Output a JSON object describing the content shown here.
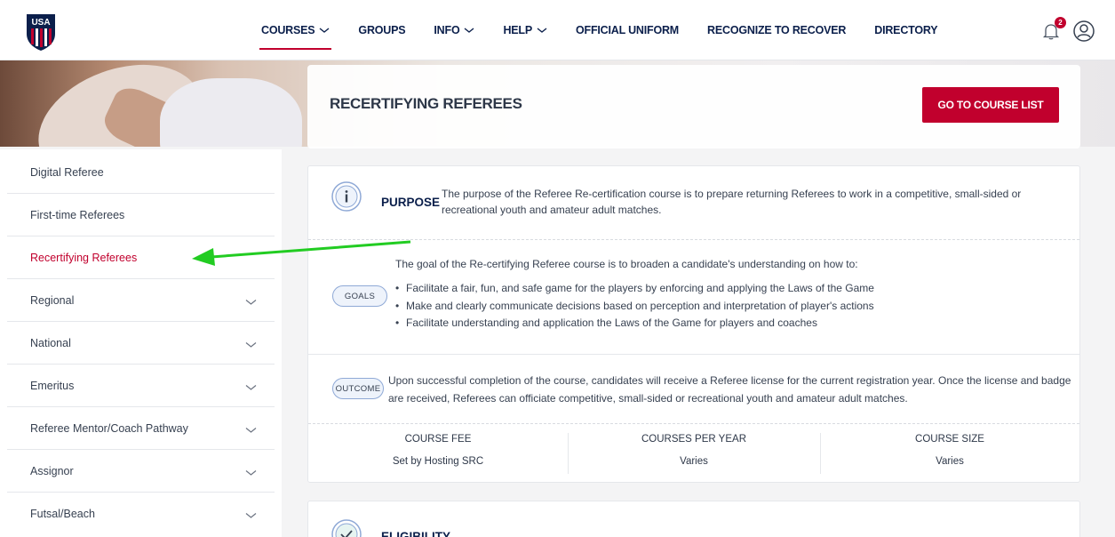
{
  "header": {
    "logo_text": "USA",
    "nav": [
      {
        "label": "COURSES",
        "has_chevron": true,
        "active": true
      },
      {
        "label": "GROUPS",
        "has_chevron": false
      },
      {
        "label": "INFO",
        "has_chevron": true
      },
      {
        "label": "HELP",
        "has_chevron": true
      },
      {
        "label": "OFFICIAL UNIFORM",
        "has_chevron": false
      },
      {
        "label": "RECOGNIZE TO RECOVER",
        "has_chevron": false
      },
      {
        "label": "DIRECTORY",
        "has_chevron": false
      }
    ],
    "notification_count": "2",
    "icons": [
      "bell-icon",
      "user-icon"
    ]
  },
  "hero": {
    "title": "RECERTIFYING REFEREES",
    "button_label": "GO TO COURSE LIST"
  },
  "sidebar": {
    "items": [
      {
        "label": "Digital Referee",
        "expandable": false
      },
      {
        "label": "First-time Referees",
        "expandable": false
      },
      {
        "label": "Recertifying Referees",
        "expandable": false,
        "active": true
      },
      {
        "label": "Regional",
        "expandable": true
      },
      {
        "label": "National",
        "expandable": true
      },
      {
        "label": "Emeritus",
        "expandable": true
      },
      {
        "label": "Referee Mentor/Coach Pathway",
        "expandable": true
      },
      {
        "label": "Assignor",
        "expandable": true
      },
      {
        "label": "Futsal/Beach",
        "expandable": true
      }
    ]
  },
  "main": {
    "purpose": {
      "label": "PURPOSE",
      "text": "The purpose of the Referee Re-certification course is to prepare returning Referees to work in a competitive, small-sided or recreational youth and amateur adult matches."
    },
    "goals": {
      "label": "GOALS",
      "intro": "The goal of the Re-certifying Referee course is to broaden a candidate's understanding on how to:",
      "items": [
        "Facilitate a fair, fun, and safe game for the players by enforcing and applying the Laws of the Game",
        "Make and clearly communicate decisions based on perception and interpretation of player's actions",
        "Facilitate understanding and application the Laws of the Game for players and coaches"
      ]
    },
    "outcome": {
      "label": "OUTCOME",
      "text": "Upon successful completion of the course, candidates will receive a Referee license for the current registration year. Once the license and badge are received, Referees can officiate competitive, small-sided or recreational youth and amateur adult matches."
    },
    "stats": [
      {
        "label": "COURSE FEE",
        "value": "Set by Hosting SRC"
      },
      {
        "label": "COURSES PER YEAR",
        "value": "Varies"
      },
      {
        "label": "COURSE SIZE",
        "value": "Varies"
      }
    ],
    "eligibility": {
      "label": "ELIGIBILITY"
    }
  },
  "colors": {
    "brand_red": "#c1002d",
    "navy": "#0b1f4b",
    "arrow_green": "#22cc22",
    "pill_border": "#8fa9d6"
  }
}
